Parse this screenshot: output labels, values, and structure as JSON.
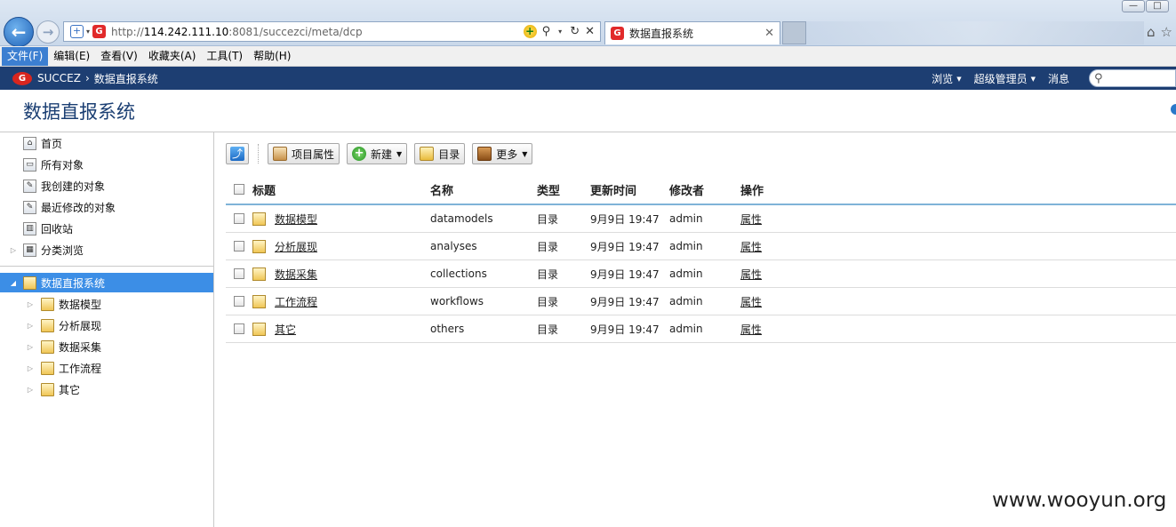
{
  "browser": {
    "url_prefix": "http://",
    "url_host": "114.242.111.10",
    "url_rest": ":8081/succezci/meta/dcp",
    "tab_title": "数据直报系统"
  },
  "menu": [
    "文件(F)",
    "编辑(E)",
    "查看(V)",
    "收藏夹(A)",
    "工具(T)",
    "帮助(H)"
  ],
  "topnav": {
    "brand": "SUCCEZ",
    "crumb": "数据直报系统",
    "browse": "浏览",
    "admin": "超级管理员",
    "messages": "消息"
  },
  "page_title": "数据直报系统",
  "sidebar": {
    "top_items": [
      "首页",
      "所有对象",
      "我创建的对象",
      "最近修改的对象",
      "回收站",
      "分类浏览"
    ],
    "root": "数据直报系统",
    "children": [
      "数据模型",
      "分析展现",
      "数据采集",
      "工作流程",
      "其它"
    ]
  },
  "toolbar": {
    "props": "项目属性",
    "new": "新建",
    "folder": "目录",
    "more": "更多"
  },
  "table": {
    "headers": [
      "标题",
      "名称",
      "类型",
      "更新时间",
      "修改者",
      "操作"
    ],
    "rows": [
      {
        "title": "数据模型",
        "name": "datamodels",
        "type": "目录",
        "time": "9月9日 19:47",
        "modifier": "admin",
        "op": "属性"
      },
      {
        "title": "分析展现",
        "name": "analyses",
        "type": "目录",
        "time": "9月9日 19:47",
        "modifier": "admin",
        "op": "属性"
      },
      {
        "title": "数据采集",
        "name": "collections",
        "type": "目录",
        "time": "9月9日 19:47",
        "modifier": "admin",
        "op": "属性"
      },
      {
        "title": "工作流程",
        "name": "workflows",
        "type": "目录",
        "time": "9月9日 19:47",
        "modifier": "admin",
        "op": "属性"
      },
      {
        "title": "其它",
        "name": "others",
        "type": "目录",
        "time": "9月9日 19:47",
        "modifier": "admin",
        "op": "属性"
      }
    ]
  },
  "watermark": "www.wooyun.org"
}
